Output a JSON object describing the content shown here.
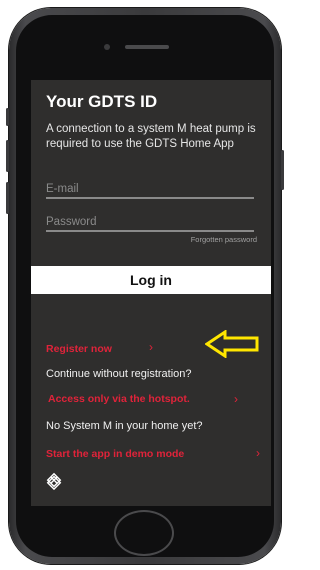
{
  "screen": {
    "title": "Your GDTS ID",
    "description": "A connection to a system M heat pump is required to use the GDTS Home App",
    "email_placeholder": "E-mail",
    "password_placeholder": "Password",
    "forgot_password": "Forgotten password",
    "login_label": "Log in",
    "register_now": "Register now",
    "continue_without": "Continue without registration?",
    "hotspot_access": "Access only via the hotspot.",
    "no_system": "No System M in your home yet?",
    "demo_mode": "Start the app in demo mode",
    "chevron": "›"
  },
  "colors": {
    "accent_red": "#e0233a",
    "screen_bg": "#2f2e2d",
    "arrow_yellow": "#ffe600"
  },
  "icons": {
    "logo": "knot-logo-icon",
    "annotation": "left-arrow-outline-icon"
  }
}
